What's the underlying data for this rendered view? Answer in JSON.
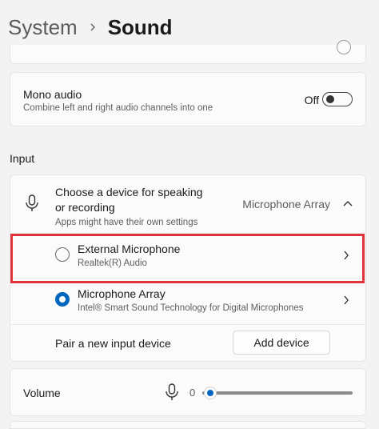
{
  "header": {
    "parent": "System",
    "current": "Sound"
  },
  "mono_audio": {
    "title": "Mono audio",
    "subtitle": "Combine left and right audio channels into one",
    "state_label": "Off",
    "enabled": false
  },
  "input_section": {
    "label": "Input",
    "choose_device": {
      "title": "Choose a device for speaking or recording",
      "subtitle": "Apps might have their own settings",
      "selected_value": "Microphone Array",
      "expanded": true
    },
    "devices": [
      {
        "name": "External Microphone",
        "driver": "Realtek(R) Audio",
        "selected": false,
        "highlighted": true
      },
      {
        "name": "Microphone Array",
        "driver": "Intel® Smart Sound Technology for Digital Microphones",
        "selected": true,
        "highlighted": false
      }
    ],
    "pair": {
      "label": "Pair a new input device",
      "button_label": "Add device"
    }
  },
  "volume": {
    "label": "Volume",
    "value": "0",
    "level": 0
  },
  "colors": {
    "accent": "#0067c0",
    "highlight": "#e0333a"
  },
  "icons": {
    "breadcrumb_separator": "chevron-right-icon",
    "input_device": "microphone-icon",
    "collapse": "chevron-up-icon",
    "open_device": "chevron-right-icon"
  }
}
